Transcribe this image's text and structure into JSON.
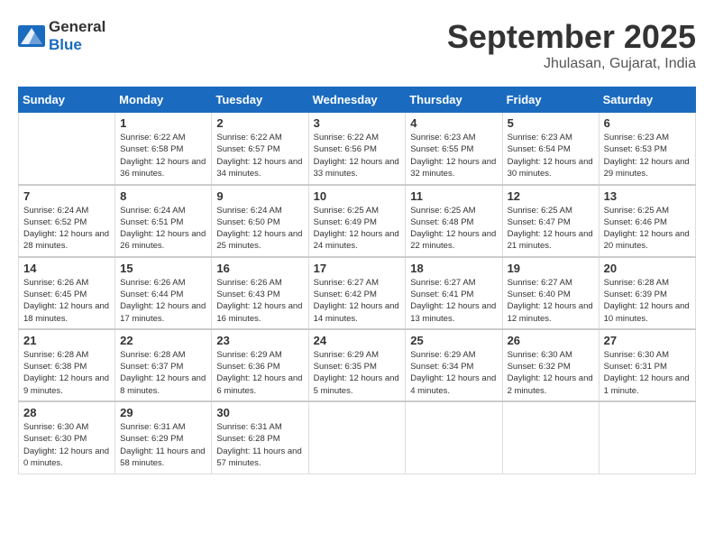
{
  "header": {
    "logo_general": "General",
    "logo_blue": "Blue",
    "month": "September 2025",
    "location": "Jhulasan, Gujarat, India"
  },
  "days": [
    "Sunday",
    "Monday",
    "Tuesday",
    "Wednesday",
    "Thursday",
    "Friday",
    "Saturday"
  ],
  "weeks": [
    [
      {
        "num": "",
        "sunrise": "",
        "sunset": "",
        "daylight": "",
        "empty": true
      },
      {
        "num": "1",
        "sunrise": "Sunrise: 6:22 AM",
        "sunset": "Sunset: 6:58 PM",
        "daylight": "Daylight: 12 hours and 36 minutes."
      },
      {
        "num": "2",
        "sunrise": "Sunrise: 6:22 AM",
        "sunset": "Sunset: 6:57 PM",
        "daylight": "Daylight: 12 hours and 34 minutes."
      },
      {
        "num": "3",
        "sunrise": "Sunrise: 6:22 AM",
        "sunset": "Sunset: 6:56 PM",
        "daylight": "Daylight: 12 hours and 33 minutes."
      },
      {
        "num": "4",
        "sunrise": "Sunrise: 6:23 AM",
        "sunset": "Sunset: 6:55 PM",
        "daylight": "Daylight: 12 hours and 32 minutes."
      },
      {
        "num": "5",
        "sunrise": "Sunrise: 6:23 AM",
        "sunset": "Sunset: 6:54 PM",
        "daylight": "Daylight: 12 hours and 30 minutes."
      },
      {
        "num": "6",
        "sunrise": "Sunrise: 6:23 AM",
        "sunset": "Sunset: 6:53 PM",
        "daylight": "Daylight: 12 hours and 29 minutes."
      }
    ],
    [
      {
        "num": "7",
        "sunrise": "Sunrise: 6:24 AM",
        "sunset": "Sunset: 6:52 PM",
        "daylight": "Daylight: 12 hours and 28 minutes."
      },
      {
        "num": "8",
        "sunrise": "Sunrise: 6:24 AM",
        "sunset": "Sunset: 6:51 PM",
        "daylight": "Daylight: 12 hours and 26 minutes."
      },
      {
        "num": "9",
        "sunrise": "Sunrise: 6:24 AM",
        "sunset": "Sunset: 6:50 PM",
        "daylight": "Daylight: 12 hours and 25 minutes."
      },
      {
        "num": "10",
        "sunrise": "Sunrise: 6:25 AM",
        "sunset": "Sunset: 6:49 PM",
        "daylight": "Daylight: 12 hours and 24 minutes."
      },
      {
        "num": "11",
        "sunrise": "Sunrise: 6:25 AM",
        "sunset": "Sunset: 6:48 PM",
        "daylight": "Daylight: 12 hours and 22 minutes."
      },
      {
        "num": "12",
        "sunrise": "Sunrise: 6:25 AM",
        "sunset": "Sunset: 6:47 PM",
        "daylight": "Daylight: 12 hours and 21 minutes."
      },
      {
        "num": "13",
        "sunrise": "Sunrise: 6:25 AM",
        "sunset": "Sunset: 6:46 PM",
        "daylight": "Daylight: 12 hours and 20 minutes."
      }
    ],
    [
      {
        "num": "14",
        "sunrise": "Sunrise: 6:26 AM",
        "sunset": "Sunset: 6:45 PM",
        "daylight": "Daylight: 12 hours and 18 minutes."
      },
      {
        "num": "15",
        "sunrise": "Sunrise: 6:26 AM",
        "sunset": "Sunset: 6:44 PM",
        "daylight": "Daylight: 12 hours and 17 minutes."
      },
      {
        "num": "16",
        "sunrise": "Sunrise: 6:26 AM",
        "sunset": "Sunset: 6:43 PM",
        "daylight": "Daylight: 12 hours and 16 minutes."
      },
      {
        "num": "17",
        "sunrise": "Sunrise: 6:27 AM",
        "sunset": "Sunset: 6:42 PM",
        "daylight": "Daylight: 12 hours and 14 minutes."
      },
      {
        "num": "18",
        "sunrise": "Sunrise: 6:27 AM",
        "sunset": "Sunset: 6:41 PM",
        "daylight": "Daylight: 12 hours and 13 minutes."
      },
      {
        "num": "19",
        "sunrise": "Sunrise: 6:27 AM",
        "sunset": "Sunset: 6:40 PM",
        "daylight": "Daylight: 12 hours and 12 minutes."
      },
      {
        "num": "20",
        "sunrise": "Sunrise: 6:28 AM",
        "sunset": "Sunset: 6:39 PM",
        "daylight": "Daylight: 12 hours and 10 minutes."
      }
    ],
    [
      {
        "num": "21",
        "sunrise": "Sunrise: 6:28 AM",
        "sunset": "Sunset: 6:38 PM",
        "daylight": "Daylight: 12 hours and 9 minutes."
      },
      {
        "num": "22",
        "sunrise": "Sunrise: 6:28 AM",
        "sunset": "Sunset: 6:37 PM",
        "daylight": "Daylight: 12 hours and 8 minutes."
      },
      {
        "num": "23",
        "sunrise": "Sunrise: 6:29 AM",
        "sunset": "Sunset: 6:36 PM",
        "daylight": "Daylight: 12 hours and 6 minutes."
      },
      {
        "num": "24",
        "sunrise": "Sunrise: 6:29 AM",
        "sunset": "Sunset: 6:35 PM",
        "daylight": "Daylight: 12 hours and 5 minutes."
      },
      {
        "num": "25",
        "sunrise": "Sunrise: 6:29 AM",
        "sunset": "Sunset: 6:34 PM",
        "daylight": "Daylight: 12 hours and 4 minutes."
      },
      {
        "num": "26",
        "sunrise": "Sunrise: 6:30 AM",
        "sunset": "Sunset: 6:32 PM",
        "daylight": "Daylight: 12 hours and 2 minutes."
      },
      {
        "num": "27",
        "sunrise": "Sunrise: 6:30 AM",
        "sunset": "Sunset: 6:31 PM",
        "daylight": "Daylight: 12 hours and 1 minute."
      }
    ],
    [
      {
        "num": "28",
        "sunrise": "Sunrise: 6:30 AM",
        "sunset": "Sunset: 6:30 PM",
        "daylight": "Daylight: 12 hours and 0 minutes."
      },
      {
        "num": "29",
        "sunrise": "Sunrise: 6:31 AM",
        "sunset": "Sunset: 6:29 PM",
        "daylight": "Daylight: 11 hours and 58 minutes."
      },
      {
        "num": "30",
        "sunrise": "Sunrise: 6:31 AM",
        "sunset": "Sunset: 6:28 PM",
        "daylight": "Daylight: 11 hours and 57 minutes."
      },
      {
        "num": "",
        "sunrise": "",
        "sunset": "",
        "daylight": "",
        "empty": true
      },
      {
        "num": "",
        "sunrise": "",
        "sunset": "",
        "daylight": "",
        "empty": true
      },
      {
        "num": "",
        "sunrise": "",
        "sunset": "",
        "daylight": "",
        "empty": true
      },
      {
        "num": "",
        "sunrise": "",
        "sunset": "",
        "daylight": "",
        "empty": true
      }
    ]
  ]
}
